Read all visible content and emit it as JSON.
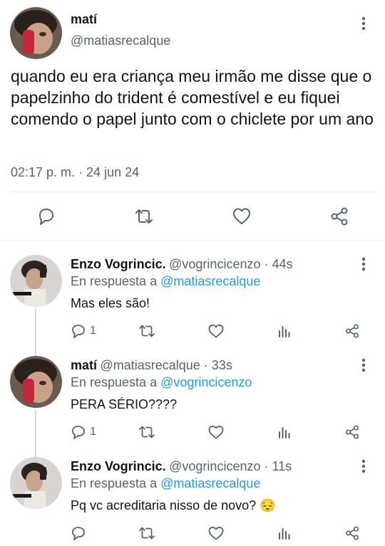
{
  "main_tweet": {
    "name": "matí",
    "handle": "@matiasrecalque",
    "text": "quando eu era criança meu irmão me disse que o papelzinho do trident é comestível e eu fiquei comendo o papel junto com o chiclete por um ano",
    "timestamp": "02:17 p. m. · 24 jun 24",
    "actions": [
      "reply-icon",
      "retweet-icon",
      "like-icon",
      "share-icon"
    ]
  },
  "replies": [
    {
      "name": "Enzo Vogrincic.",
      "handle_time": "@vogrincicenzo · 44s",
      "in_reply_prefix": "En respuesta a",
      "in_reply_to": "@matiasrecalque",
      "text": "Mas eles são!",
      "reply_count": "1"
    },
    {
      "name": "matí",
      "handle_time": "@matiasrecalque · 33s",
      "in_reply_prefix": "En respuesta a",
      "in_reply_to": "@vogrincicenzo",
      "text": "PERA SÉRIO????",
      "reply_count": "1"
    },
    {
      "name": "Enzo Vogrincic.",
      "handle_time": "@vogrincicenzo · 11s",
      "in_reply_prefix": "En respuesta a",
      "in_reply_to": "@matiasrecalque",
      "text": "Pq vc acreditaria nisso de novo? 😔",
      "reply_count": ""
    }
  ],
  "colors": {
    "text": "#0f1419",
    "secondary": "#536471",
    "link": "#1d9bf0",
    "divider": "#e6ecf0"
  }
}
